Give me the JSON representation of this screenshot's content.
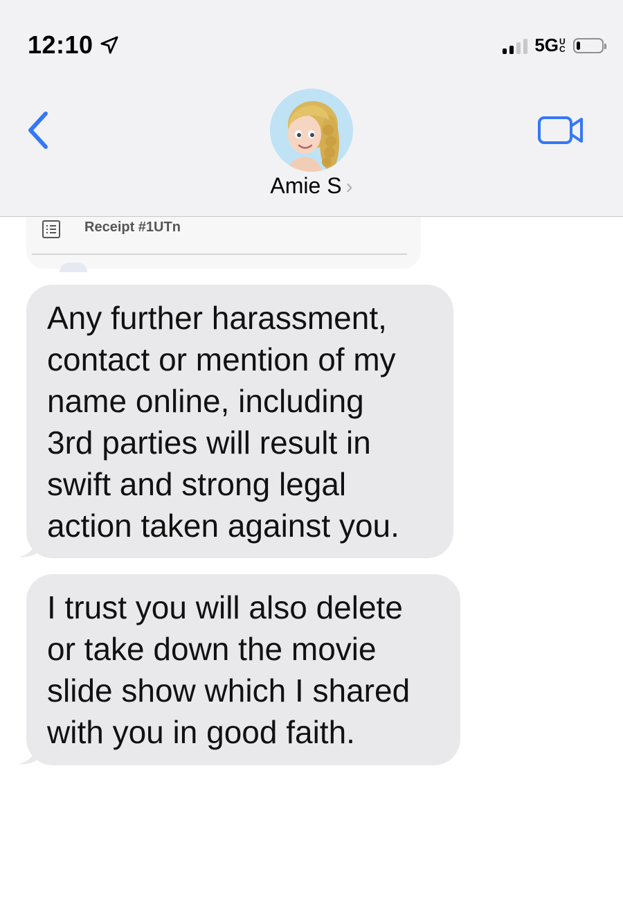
{
  "status_bar": {
    "time": "12:10",
    "network": "5G",
    "network_suffix": "UC",
    "signal_bars_active": 2,
    "signal_bars_total": 4,
    "battery_level": 0.15
  },
  "nav": {
    "contact_name": "Amie S",
    "back_icon": "chevron-left-icon",
    "video_icon": "video-camera-icon",
    "accent_color": "#3478f6"
  },
  "conversation": {
    "receipt_preview": {
      "label": "Receipt #1UTn",
      "icon": "list-icon"
    },
    "messages": [
      {
        "direction": "incoming",
        "text": "Any further harassment,\ncontact or mention of my\nname online, including\n3rd parties will result in\nswift and strong legal\naction taken against you."
      },
      {
        "direction": "incoming",
        "text": "I trust you will also delete\nor take down the movie\nslide show which I shared\nwith you in good faith."
      }
    ],
    "incoming_bubble_color": "#e9e9eb"
  }
}
